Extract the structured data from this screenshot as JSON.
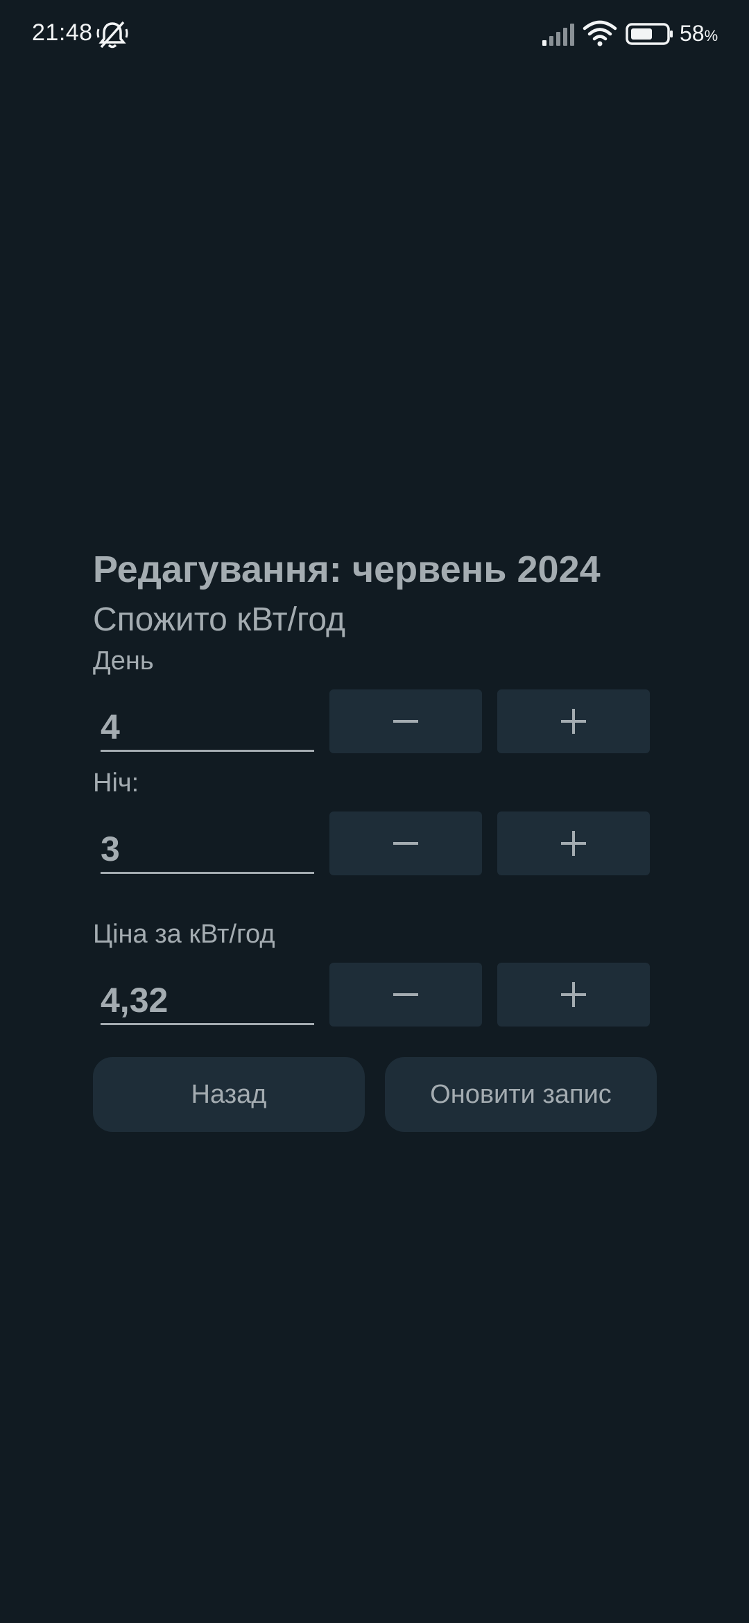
{
  "status_bar": {
    "time": "21:48",
    "battery_level": "58",
    "battery_unit": "%",
    "icons": [
      "bell-muted-icon",
      "signal-icon",
      "wifi-icon",
      "battery-icon"
    ]
  },
  "form": {
    "title": "Редагування: червень 2024",
    "subtitle": "Спожито кВт/год",
    "day": {
      "label": "День",
      "value": "4"
    },
    "night": {
      "label": "Ніч:",
      "value": "3"
    },
    "price": {
      "label": "Ціна за кВт/год",
      "value": "4,32"
    },
    "stepper_icons": [
      "minus-icon",
      "plus-icon"
    ]
  },
  "actions": {
    "back_label": "Назад",
    "update_label": "Оновити запис"
  },
  "colors": {
    "background": "#111b22",
    "button_bg": "#1e2d38",
    "text": "#a4acb1"
  }
}
